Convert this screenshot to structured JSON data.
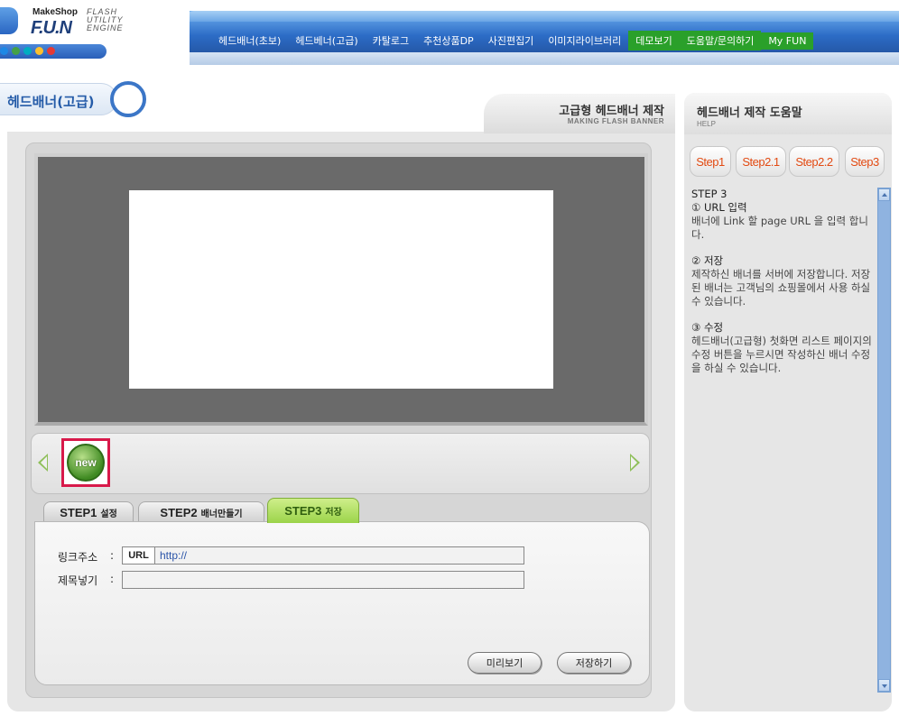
{
  "brand": {
    "small": "MakeShop",
    "big": "F.U.N",
    "right_lines": [
      "FLASH",
      "UTILITY",
      "ENGINE"
    ]
  },
  "colors": {
    "nav_blue": "#2c6cc6",
    "nav_highlight": "#2aa02a",
    "accent_orange": "#e24a12",
    "tab_active": "#9bd44a",
    "selected_border": "#d8194a",
    "dots": [
      "#1e88e5",
      "#43a047",
      "#00acc1",
      "#fbc02d",
      "#e53935"
    ]
  },
  "nav": [
    {
      "label": "헤드배너(초보)",
      "highlight": false
    },
    {
      "label": "헤드베너(고급)",
      "highlight": false
    },
    {
      "label": "카탈로그",
      "highlight": false
    },
    {
      "label": "추천상품DP",
      "highlight": false
    },
    {
      "label": "사진편집기",
      "highlight": false
    },
    {
      "label": "이미지라이브러리",
      "highlight": false
    },
    {
      "label": "데모보기",
      "highlight": true
    },
    {
      "label": "도움말/문의하기",
      "highlight": true
    },
    {
      "label": "My FUN",
      "highlight": true
    }
  ],
  "page_title": "헤드배너(고급)",
  "content_header": {
    "title": "고급형 헤드배너 제작",
    "subtitle": "MAKING FLASH BANNER"
  },
  "thumbnail": {
    "new_label": "new",
    "icons": {
      "prev": "triangle-left-icon",
      "next": "triangle-right-icon"
    }
  },
  "tabs": [
    {
      "label": "STEP1",
      "sub": "설정"
    },
    {
      "label": "STEP2",
      "sub": "배너만들기"
    },
    {
      "label": "STEP3",
      "sub": "저장",
      "active": true
    }
  ],
  "form": {
    "link_label": "링크주소",
    "title_label": "제목넣기",
    "colon": ":",
    "url_prefix": "URL",
    "url_value": "http://",
    "title_value": ""
  },
  "buttons": {
    "preview": "미리보기",
    "save": "저장하기"
  },
  "help": {
    "title": "헤드배너 제작 도움말",
    "subtitle": "HELP",
    "step_tabs": [
      "Step1",
      "Step2.1",
      "Step2.2",
      "Step3"
    ],
    "sections": [
      {
        "head": "STEP 3",
        "sub": "① URL 입력",
        "desc": "배너에 Link 할 page URL 을 입력 합니다."
      },
      {
        "head": "② 저장",
        "desc": "제작하신 배너를 서버에 저장합니다. 저장된 배너는 고객님의 쇼핑몰에서 사용 하실 수 있습니다."
      },
      {
        "head": "③ 수정",
        "desc": "헤드배너(고급형) 첫화면 리스트 페이지의 수정 버튼을 누르시면 작성하신 배너 수정을 하실 수 있습니다."
      }
    ]
  }
}
